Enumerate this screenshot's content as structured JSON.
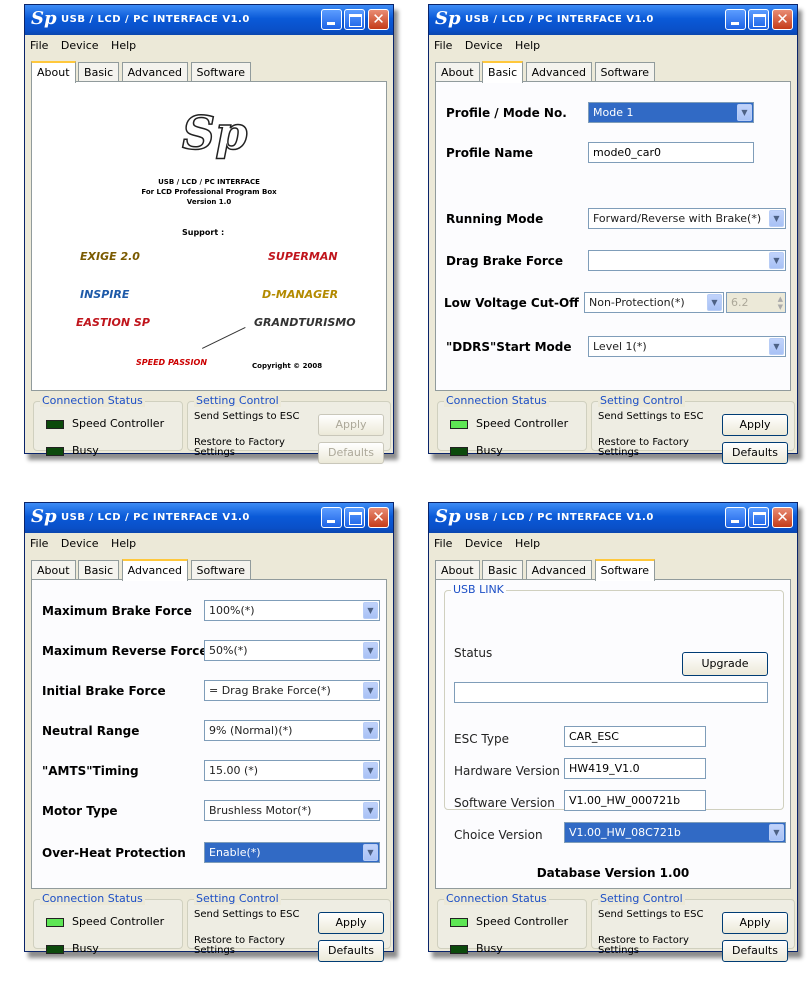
{
  "app": {
    "title": "USB / LCD / PC INTERFACE V1.0",
    "logo": "Sp"
  },
  "menu": [
    "File",
    "Device",
    "Help"
  ],
  "tabs": [
    "About",
    "Basic",
    "Advanced",
    "Software"
  ],
  "status": {
    "title": "Connection Status",
    "speed_controller": "Speed Controller",
    "busy": "Busy"
  },
  "setting": {
    "title": "Setting Control",
    "send_text": "Send Settings to ESC",
    "restore_text": "Restore to Factory Settings",
    "apply": "Apply",
    "defaults": "Defaults"
  },
  "about": {
    "line1": "USB / LCD / PC INTERFACE",
    "line2": "For LCD Professional Program Box",
    "line3": "Version 1.0",
    "support": "Support :",
    "brands": [
      "EXIGE 2.0",
      "SUPERMAN",
      "INSPIRE",
      "D-MANAGER",
      "EASTION SP",
      "GRANDTURISMO"
    ],
    "signature": "SPEED PASSION",
    "copyright": "Copyright © 2008"
  },
  "basic": {
    "profile_label": "Profile / Mode No.",
    "profile_value": "Mode 1",
    "name_label": "Profile Name",
    "name_value": "mode0_car0",
    "running_label": "Running Mode",
    "running_value": "Forward/Reverse with Brake(*)",
    "drag_label": "Drag Brake Force",
    "drag_value": "",
    "lowvolt_label": "Low Voltage Cut-Off",
    "lowvolt_value": "Non-Protection(*)",
    "lowvolt_num": "6.2",
    "ddrs_label": "\"DDRS\"Start Mode",
    "ddrs_value": "Level 1(*)"
  },
  "advanced": {
    "rows": [
      {
        "label": "Maximum Brake Force",
        "value": "100%(*)"
      },
      {
        "label": "Maximum Reverse Force",
        "value": "50%(*)"
      },
      {
        "label": "Initial Brake Force",
        "value": "= Drag Brake Force(*)"
      },
      {
        "label": "Neutral Range",
        "value": "9% (Normal)(*)"
      },
      {
        "label": "\"AMTS\"Timing",
        "value": "15.00 (*)"
      },
      {
        "label": "Motor Type",
        "value": "Brushless Motor(*)"
      },
      {
        "label": "Over-Heat Protection",
        "value": "Enable(*)"
      }
    ]
  },
  "software": {
    "group_title": "USB LINK",
    "status_label": "Status",
    "status_value": "",
    "upgrade": "Upgrade",
    "esc_type_label": "ESC Type",
    "esc_type_value": "CAR_ESC",
    "hw_label": "Hardware Version",
    "hw_value": "HW419_V1.0",
    "sw_label": "Software Version",
    "sw_value": "V1.00_HW_000721b",
    "choice_label": "Choice Version",
    "choice_value": "V1.00_HW_08C721b",
    "db_version": "Database Version 1.00"
  },
  "colors": {
    "titlebar": "#0a5ad8",
    "selection": "#316ac5",
    "led_on": "#5ee655",
    "led_off": "#0c4a0c"
  },
  "icons": [
    "app-logo-icon",
    "minimize-icon",
    "maximize-icon",
    "close-icon",
    "dropdown-arrow-icon",
    "spin-icon"
  ]
}
